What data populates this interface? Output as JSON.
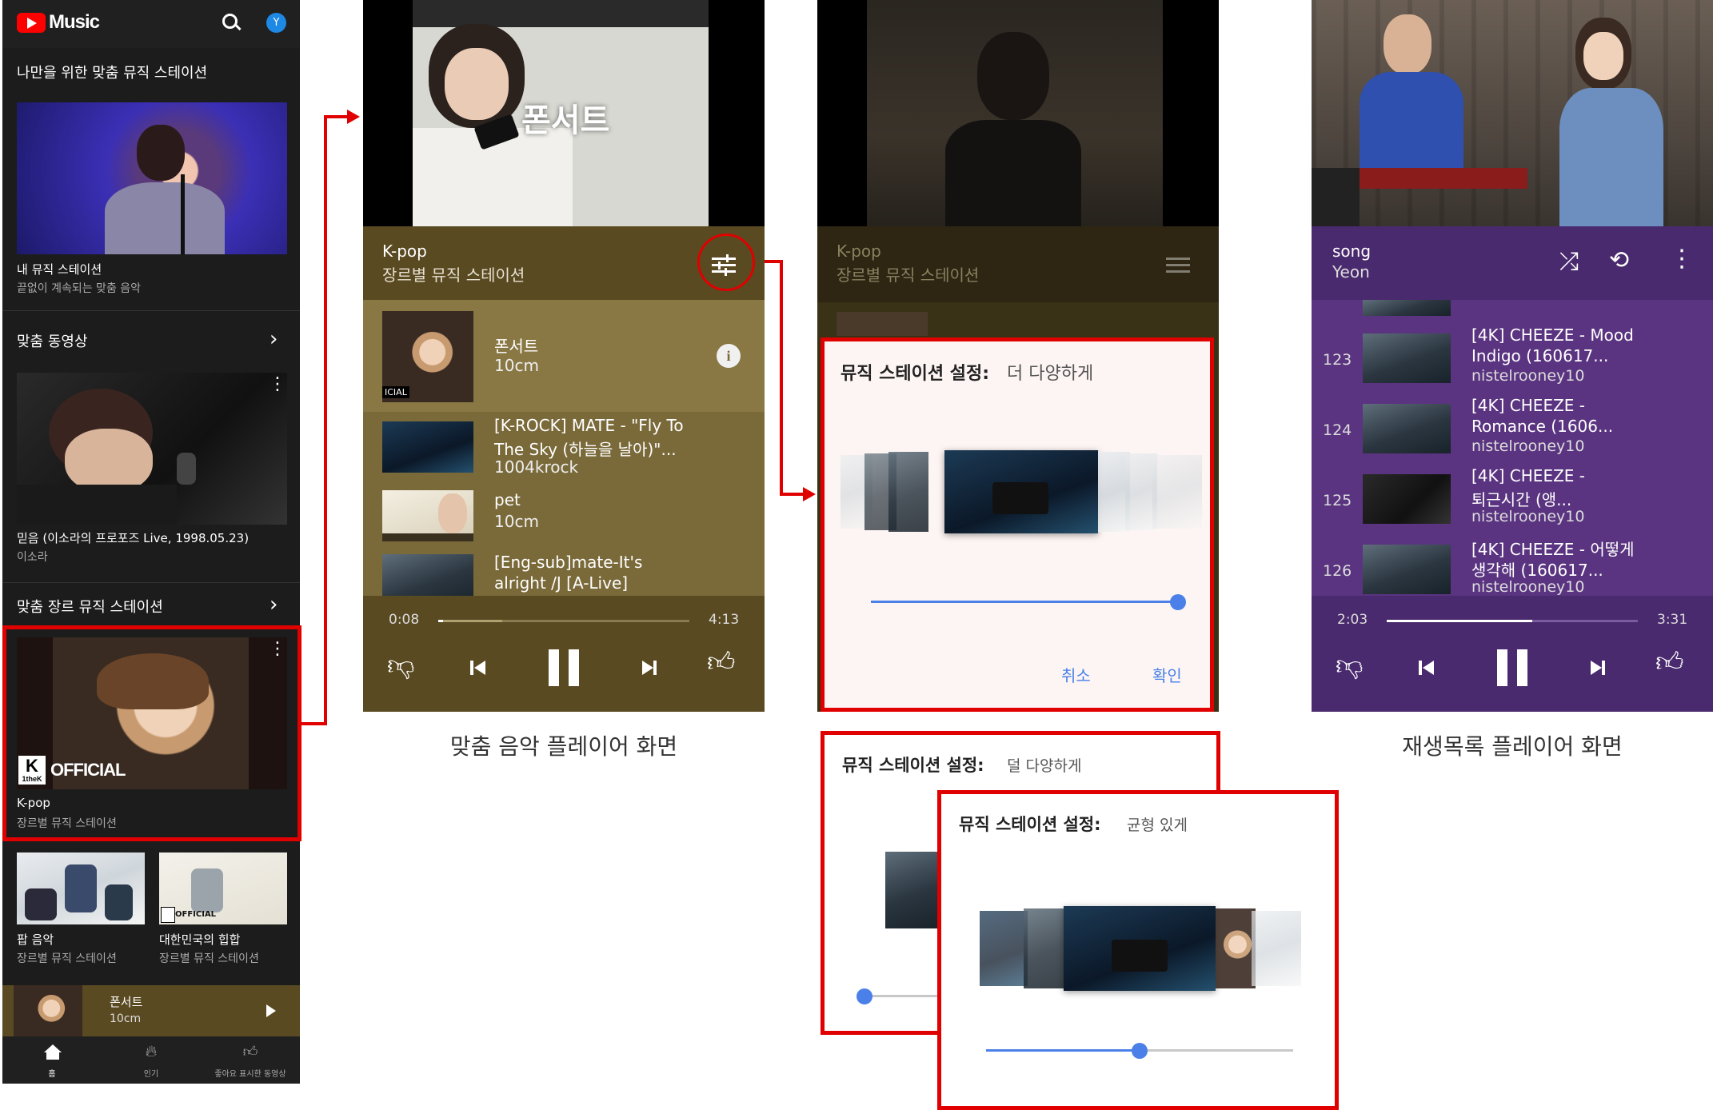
{
  "panel1": {
    "app_name": "Music",
    "avatar_letter": "Y",
    "section_title": "나만을 위한 맞춤 뮤직 스테이션",
    "card1": {
      "title": "내 뮤직 스테이션",
      "subtitle": "끝없이 계속되는 맞춤 음악"
    },
    "section2": "맞춤 동영상",
    "card2": {
      "title": "믿음 (이소라의 프로포즈 Live, 1998.05.23)",
      "subtitle": "이소라"
    },
    "section3": "맞춤 장르 뮤직 스테이션",
    "card3": {
      "title": "K-pop",
      "subtitle": "장르별 뮤직 스테이션",
      "badge_k": "K",
      "badge_sub": "1theK",
      "badge_official": "OFFICIAL"
    },
    "small_cards": [
      {
        "title": "팝 음악",
        "subtitle": "장르별 뮤직 스테이션"
      },
      {
        "title": "대한민국의 힙합",
        "subtitle": "장르별 뮤직 스테이션",
        "badge": "OFFICIAL"
      }
    ],
    "mini_player": {
      "title": "폰서트",
      "artist": "10cm"
    },
    "nav": [
      {
        "label": "홈",
        "icon": "home-icon"
      },
      {
        "label": "인기",
        "icon": "fire-icon"
      },
      {
        "label": "좋아요 표시한 동영상",
        "icon": "thumbs-up-icon"
      }
    ]
  },
  "panel2": {
    "video_overlay_text": "폰서트",
    "station_title": "K-pop",
    "station_subtitle": "장르별 뮤직 스테이션",
    "queue": [
      {
        "title": "폰서트",
        "artist": "10cm",
        "badge": "ICIAL"
      },
      {
        "title": "[K-ROCK] MATE - \"Fly To",
        "title2": "The Sky (하늘을 날아)\"...",
        "artist": "1004krock"
      },
      {
        "title": "pet",
        "artist": "10cm"
      },
      {
        "title": "[Eng-sub]mate-It's",
        "title2": "alright /J [A-Live]"
      }
    ],
    "time_current": "0:08",
    "time_total": "4:13",
    "progress": 0.02,
    "caption": "맞춤 음악 플레이어 화면"
  },
  "panel3": {
    "station_title": "K-pop",
    "station_subtitle": "장르별 뮤직 스테이션",
    "dialog": {
      "title": "뮤직 스테이션 설정:",
      "value": "더 다양하게",
      "slider": 1.0,
      "cancel": "취소",
      "confirm": "확인"
    }
  },
  "panel4": {
    "song_title": "song",
    "artist": "Yeon",
    "list": [
      {
        "index": "123",
        "title": "[4K] CHEEZE - Mood",
        "title2": "Indigo (160617...",
        "channel": "nistelrooney10"
      },
      {
        "index": "124",
        "title": "[4K] CHEEZE -",
        "title2": "Romance (1606...",
        "channel": "nistelrooney10"
      },
      {
        "index": "125",
        "title": "[4K] CHEEZE -",
        "title2": "퇴근시간 (앵...",
        "channel": "nistelrooney10"
      },
      {
        "index": "126",
        "title": "[4K] CHEEZE - 어떻게",
        "title2": "생각해 (160617...",
        "channel": "nistelrooney10"
      }
    ],
    "time_current": "2:03",
    "time_total": "3:31",
    "progress": 0.58,
    "caption": "재생목록 플레이어 화면"
  },
  "dialog_less": {
    "title": "뮤직 스테이션 설정:",
    "value": "덜 다양하게",
    "slider": 0.0
  },
  "dialog_balanced": {
    "title": "뮤직 스테이션 설정:",
    "value": "균형 있게",
    "slider": 0.5
  },
  "colors": {
    "highlight": "#e00000",
    "accent_blue": "#4a80e8",
    "kpop_bg": "#5a4a22",
    "playlist_bg": "#4a2a6e"
  }
}
